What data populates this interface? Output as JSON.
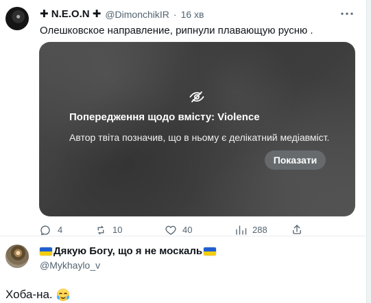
{
  "tweets": [
    {
      "display_name": "✚ N.E.O.N ✚",
      "handle": "@DimonchikIR",
      "separator": "·",
      "timestamp": "16 хв",
      "text": "Олешковское направление, рипнули плавающую русню .",
      "media_warning": {
        "title": "Попередження щодо вмісту: Violence",
        "body": "Автор твіта позначив, що в ньому є делікатний медіавміст.",
        "button_label": "Показати"
      },
      "actions": {
        "replies": "4",
        "retweets": "10",
        "likes": "40",
        "views": "288"
      },
      "icons": {
        "more": "more-icon",
        "warning": "eye-off-icon",
        "reply": "reply-icon",
        "retweet": "retweet-icon",
        "like": "heart-icon",
        "views": "views-icon",
        "share": "share-icon"
      }
    },
    {
      "display_name": "Дякую Богу, що я не москаль",
      "handle": "@Mykhaylo_v",
      "text": "Хоба-на.",
      "icons": {
        "flag": "ukraine-flag-icon",
        "emoji": "tears-of-joy-emoji"
      }
    }
  ]
}
